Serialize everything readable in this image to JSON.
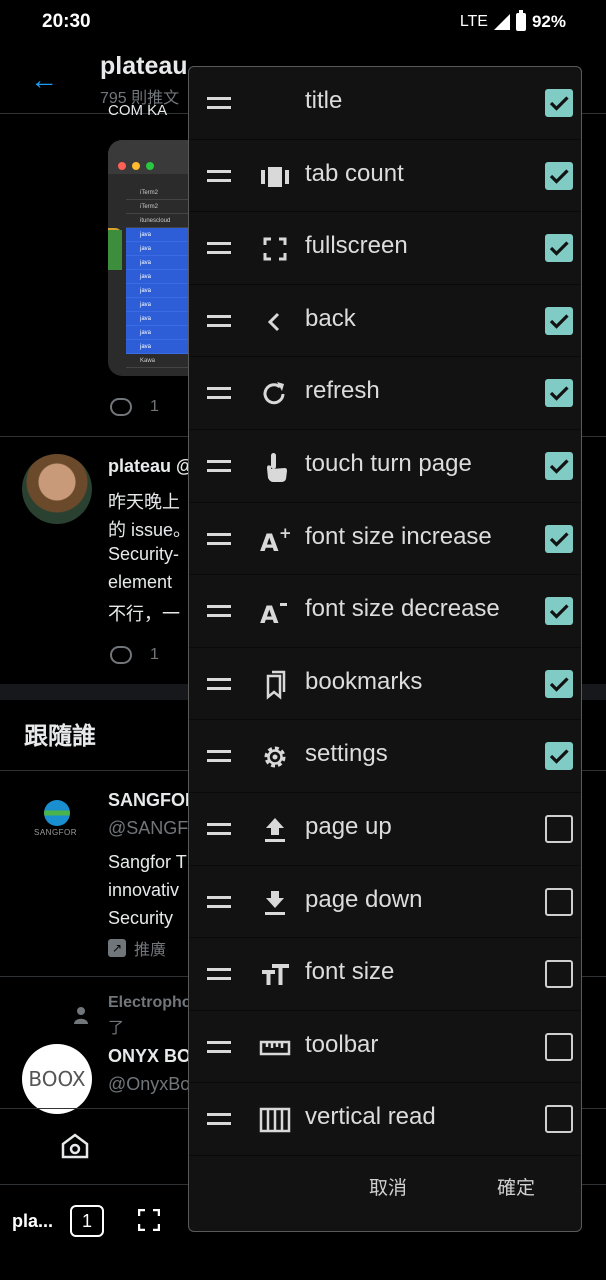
{
  "status_bar": {
    "time": "20:30",
    "network": "LTE",
    "battery": "92%"
  },
  "profile": {
    "name": "plateau",
    "subtitle": "795 則推文",
    "cut_text": "COM KA"
  },
  "image_list": {
    "rows": [
      "iTerm2",
      "iTerm2",
      "itunescloud",
      "java",
      "java",
      "java",
      "java",
      "java",
      "java",
      "java",
      "java",
      "java",
      "Kawa"
    ]
  },
  "tweet1": {
    "reply_count": "1"
  },
  "tweet2": {
    "user": "plateau @",
    "lines": [
      "昨天晚上",
      "的 issue。",
      "Security-",
      "element",
      "不行，一"
    ],
    "reply_count": "1"
  },
  "who_to_follow": {
    "title": "跟隨誰",
    "sangfor": {
      "logo_text": "SANGFOR",
      "name": "SANGFOR",
      "handle": "@SANGF",
      "lines": [
        "Sangfor T",
        "innovativ",
        "Security"
      ],
      "promoted": "推廣"
    },
    "onyx": {
      "followed_by": "Electropho",
      "followed_suffix": "了",
      "name": "ONYX BO",
      "handle": "@OnyxBo",
      "avatar_text": "BOOX"
    }
  },
  "reader_bar": {
    "title": "pla...",
    "tab_count": "1"
  },
  "dialog": {
    "items": [
      {
        "label": "title",
        "icon": "none",
        "checked": true
      },
      {
        "label": "tab count",
        "icon": "tab-count-icon",
        "checked": true
      },
      {
        "label": "fullscreen",
        "icon": "fullscreen-icon",
        "checked": true
      },
      {
        "label": "back",
        "icon": "chevron-left-icon",
        "checked": true
      },
      {
        "label": "refresh",
        "icon": "refresh-icon",
        "checked": true
      },
      {
        "label": "touch turn page",
        "icon": "touch-icon",
        "checked": true
      },
      {
        "label": "font size increase",
        "icon": "font-increase-icon",
        "checked": true
      },
      {
        "label": "font size decrease",
        "icon": "font-decrease-icon",
        "checked": true
      },
      {
        "label": "bookmarks",
        "icon": "bookmarks-icon",
        "checked": true
      },
      {
        "label": "settings",
        "icon": "gear-icon",
        "checked": true
      },
      {
        "label": "page up",
        "icon": "page-up-icon",
        "checked": false
      },
      {
        "label": "page down",
        "icon": "page-down-icon",
        "checked": false
      },
      {
        "label": "font size",
        "icon": "font-size-icon",
        "checked": false
      },
      {
        "label": "toolbar",
        "icon": "ruler-icon",
        "checked": false
      },
      {
        "label": "vertical read",
        "icon": "vertical-read-icon",
        "checked": false
      }
    ],
    "cancel_label": "取消",
    "confirm_label": "確定"
  },
  "colors": {
    "accent": "#1d9bf0",
    "checkbox": "#80cbc4",
    "background": "#000000",
    "dialog": "#121212"
  }
}
